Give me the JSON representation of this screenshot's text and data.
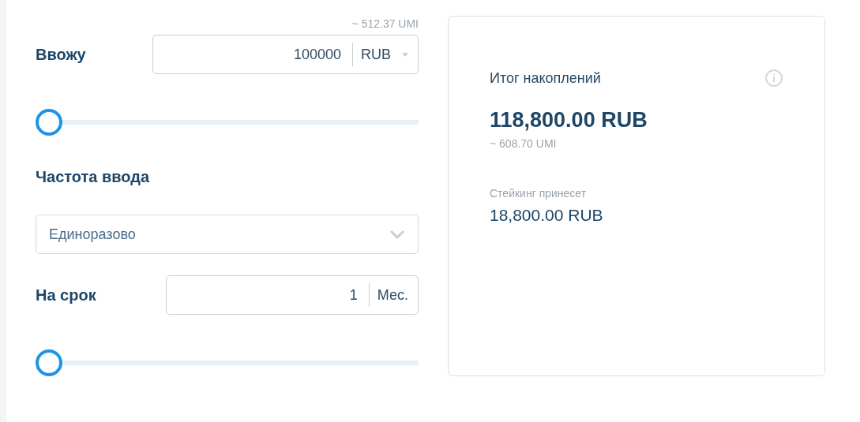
{
  "deposit": {
    "approx": "~ 512.37 UMI",
    "label": "Ввожу",
    "value": "100000",
    "currency": "RUB",
    "slider": {
      "level": 0
    }
  },
  "frequency": {
    "label": "Частота ввода",
    "value": "Единоразово"
  },
  "term": {
    "label": "На срок",
    "value": "1",
    "unit": "Мес.",
    "slider": {
      "level": 0
    }
  },
  "summary": {
    "title": "Итог накоплений",
    "total": "118,800.00 RUB",
    "total_approx": "~ 608.70 UMI",
    "staking_label": "Стейкинг принесет",
    "staking_value": "18,800.00 RUB"
  }
}
